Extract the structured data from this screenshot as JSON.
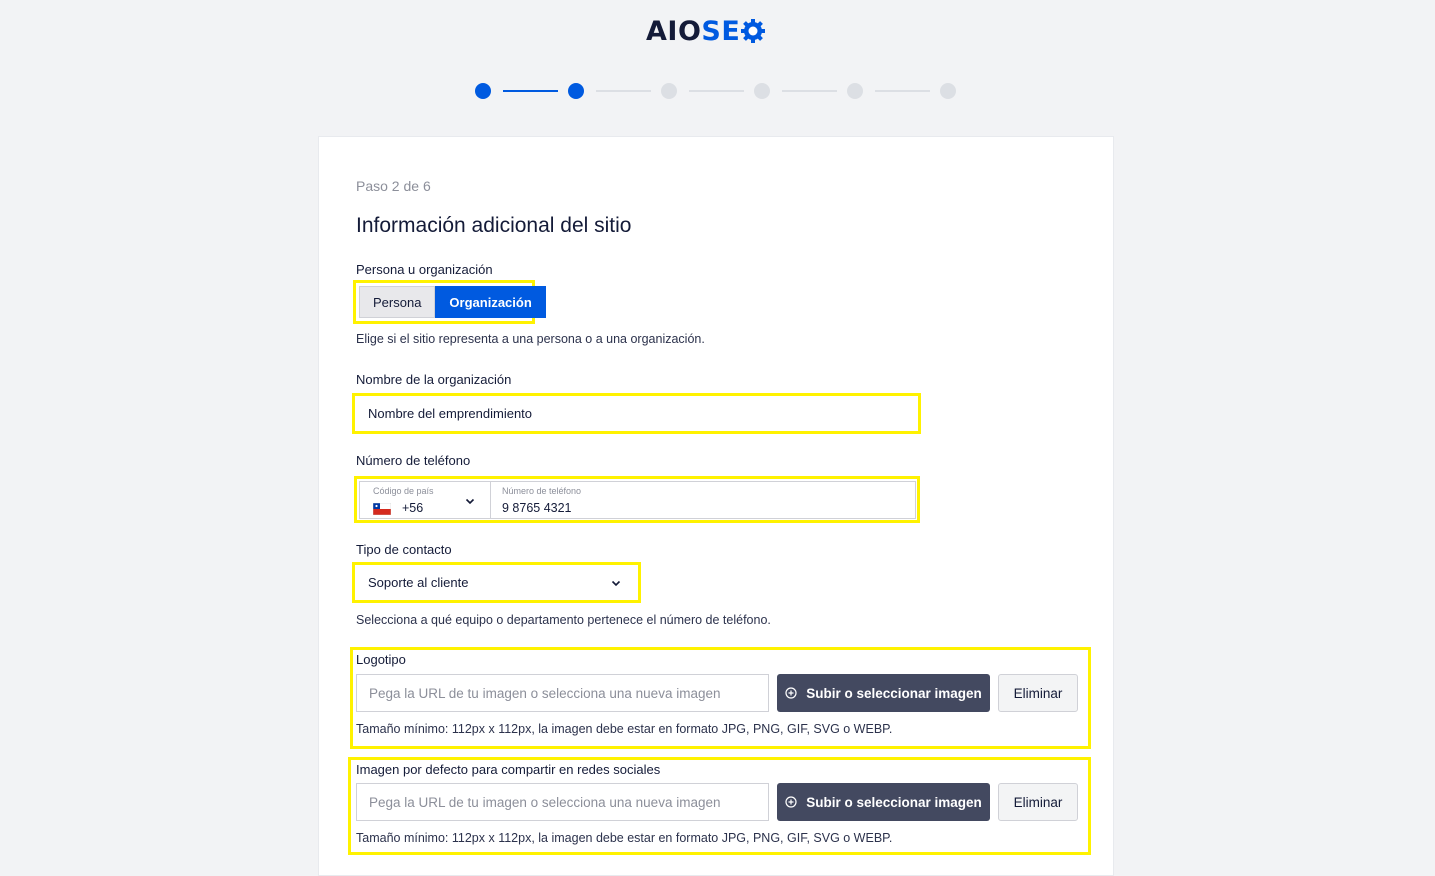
{
  "brand": {
    "aio": "AIO",
    "seo": "SE"
  },
  "stepper": {
    "total": 6,
    "current": 2
  },
  "wizard": {
    "step_label": "Paso 2 de 6",
    "title": "Información adicional del sitio"
  },
  "person_org": {
    "label": "Persona u organización",
    "options": [
      "Persona",
      "Organización"
    ],
    "selected": "Organización",
    "help": "Elige si el sitio representa a una persona o a una organización."
  },
  "org_name": {
    "label": "Nombre de la organización",
    "value": "Nombre del emprendimiento"
  },
  "phone": {
    "label": "Número de teléfono",
    "country_label": "Código de país",
    "country_code": "+56",
    "number_label": "Número de teléfono",
    "number_value": "9 8765 4321"
  },
  "contact_type": {
    "label": "Tipo de contacto",
    "value": "Soporte al cliente",
    "help": "Selecciona a qué equipo o departamento pertenece el número de teléfono."
  },
  "logo": {
    "label": "Logotipo",
    "placeholder": "Pega la URL de tu imagen o selecciona una nueva imagen",
    "upload_label": "Subir o seleccionar imagen",
    "remove_label": "Eliminar",
    "help": "Tamaño mínimo: 112px x 112px, la imagen debe estar en formato JPG, PNG, GIF, SVG o WEBP."
  },
  "social_image": {
    "label": "Imagen por defecto para compartir en redes sociales",
    "placeholder": "Pega la URL de tu imagen o selecciona una nueva imagen",
    "upload_label": "Subir o seleccionar imagen",
    "remove_label": "Eliminar",
    "help": "Tamaño mínimo: 112px x 112px, la imagen debe estar en formato JPG, PNG, GIF, SVG o WEBP."
  },
  "colors": {
    "accent": "#005ae0",
    "highlight": "#fff200",
    "dark_button": "#434960"
  }
}
